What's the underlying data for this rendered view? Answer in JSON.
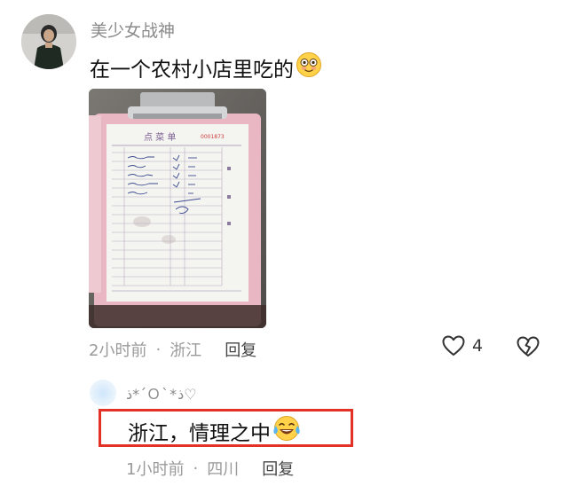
{
  "comment": {
    "username": "美少女战神",
    "text": "在一个农村小店里吃的",
    "text_emoji": "flushed-smile-emoji",
    "photo": {
      "description_icon": "receipt-photo",
      "receipt_header": "点 菜 单"
    },
    "time": "2小时前",
    "separator": "·",
    "location": "浙江",
    "reply_label": "回复",
    "like_count": "4"
  },
  "reply": {
    "username": "ذ*´Ｏ`*ذ♡",
    "text": "浙江，情理之中",
    "text_emoji": "tears-of-joy-emoji",
    "time": "1小时前",
    "separator": "·",
    "location": "四川",
    "reply_label": "回复",
    "highlight_color": "#e23127"
  },
  "colors": {
    "meta_text": "#9a9a9a",
    "username": "#8a8a8a",
    "body_text": "#111111"
  }
}
